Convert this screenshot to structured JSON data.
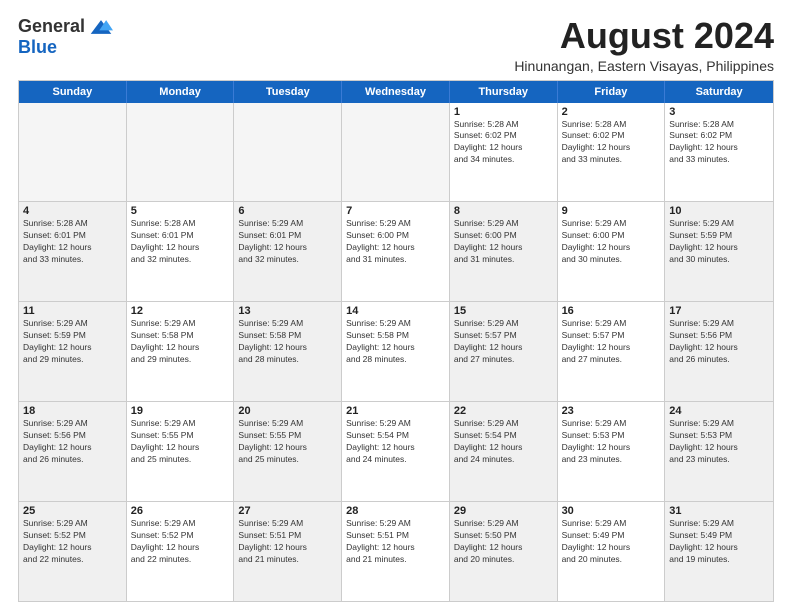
{
  "logo": {
    "general": "General",
    "blue": "Blue"
  },
  "title": "August 2024",
  "location": "Hinunangan, Eastern Visayas, Philippines",
  "header": {
    "days": [
      "Sunday",
      "Monday",
      "Tuesday",
      "Wednesday",
      "Thursday",
      "Friday",
      "Saturday"
    ]
  },
  "weeks": [
    [
      {
        "day": "",
        "info": "",
        "empty": true
      },
      {
        "day": "",
        "info": "",
        "empty": true
      },
      {
        "day": "",
        "info": "",
        "empty": true
      },
      {
        "day": "",
        "info": "",
        "empty": true
      },
      {
        "day": "1",
        "info": "Sunrise: 5:28 AM\nSunset: 6:02 PM\nDaylight: 12 hours\nand 34 minutes."
      },
      {
        "day": "2",
        "info": "Sunrise: 5:28 AM\nSunset: 6:02 PM\nDaylight: 12 hours\nand 33 minutes."
      },
      {
        "day": "3",
        "info": "Sunrise: 5:28 AM\nSunset: 6:02 PM\nDaylight: 12 hours\nand 33 minutes."
      }
    ],
    [
      {
        "day": "4",
        "info": "Sunrise: 5:28 AM\nSunset: 6:01 PM\nDaylight: 12 hours\nand 33 minutes.",
        "shaded": true
      },
      {
        "day": "5",
        "info": "Sunrise: 5:28 AM\nSunset: 6:01 PM\nDaylight: 12 hours\nand 32 minutes."
      },
      {
        "day": "6",
        "info": "Sunrise: 5:29 AM\nSunset: 6:01 PM\nDaylight: 12 hours\nand 32 minutes.",
        "shaded": true
      },
      {
        "day": "7",
        "info": "Sunrise: 5:29 AM\nSunset: 6:00 PM\nDaylight: 12 hours\nand 31 minutes."
      },
      {
        "day": "8",
        "info": "Sunrise: 5:29 AM\nSunset: 6:00 PM\nDaylight: 12 hours\nand 31 minutes.",
        "shaded": true
      },
      {
        "day": "9",
        "info": "Sunrise: 5:29 AM\nSunset: 6:00 PM\nDaylight: 12 hours\nand 30 minutes."
      },
      {
        "day": "10",
        "info": "Sunrise: 5:29 AM\nSunset: 5:59 PM\nDaylight: 12 hours\nand 30 minutes.",
        "shaded": true
      }
    ],
    [
      {
        "day": "11",
        "info": "Sunrise: 5:29 AM\nSunset: 5:59 PM\nDaylight: 12 hours\nand 29 minutes.",
        "shaded": true
      },
      {
        "day": "12",
        "info": "Sunrise: 5:29 AM\nSunset: 5:58 PM\nDaylight: 12 hours\nand 29 minutes."
      },
      {
        "day": "13",
        "info": "Sunrise: 5:29 AM\nSunset: 5:58 PM\nDaylight: 12 hours\nand 28 minutes.",
        "shaded": true
      },
      {
        "day": "14",
        "info": "Sunrise: 5:29 AM\nSunset: 5:58 PM\nDaylight: 12 hours\nand 28 minutes."
      },
      {
        "day": "15",
        "info": "Sunrise: 5:29 AM\nSunset: 5:57 PM\nDaylight: 12 hours\nand 27 minutes.",
        "shaded": true
      },
      {
        "day": "16",
        "info": "Sunrise: 5:29 AM\nSunset: 5:57 PM\nDaylight: 12 hours\nand 27 minutes."
      },
      {
        "day": "17",
        "info": "Sunrise: 5:29 AM\nSunset: 5:56 PM\nDaylight: 12 hours\nand 26 minutes.",
        "shaded": true
      }
    ],
    [
      {
        "day": "18",
        "info": "Sunrise: 5:29 AM\nSunset: 5:56 PM\nDaylight: 12 hours\nand 26 minutes.",
        "shaded": true
      },
      {
        "day": "19",
        "info": "Sunrise: 5:29 AM\nSunset: 5:55 PM\nDaylight: 12 hours\nand 25 minutes."
      },
      {
        "day": "20",
        "info": "Sunrise: 5:29 AM\nSunset: 5:55 PM\nDaylight: 12 hours\nand 25 minutes.",
        "shaded": true
      },
      {
        "day": "21",
        "info": "Sunrise: 5:29 AM\nSunset: 5:54 PM\nDaylight: 12 hours\nand 24 minutes."
      },
      {
        "day": "22",
        "info": "Sunrise: 5:29 AM\nSunset: 5:54 PM\nDaylight: 12 hours\nand 24 minutes.",
        "shaded": true
      },
      {
        "day": "23",
        "info": "Sunrise: 5:29 AM\nSunset: 5:53 PM\nDaylight: 12 hours\nand 23 minutes."
      },
      {
        "day": "24",
        "info": "Sunrise: 5:29 AM\nSunset: 5:53 PM\nDaylight: 12 hours\nand 23 minutes.",
        "shaded": true
      }
    ],
    [
      {
        "day": "25",
        "info": "Sunrise: 5:29 AM\nSunset: 5:52 PM\nDaylight: 12 hours\nand 22 minutes.",
        "shaded": true
      },
      {
        "day": "26",
        "info": "Sunrise: 5:29 AM\nSunset: 5:52 PM\nDaylight: 12 hours\nand 22 minutes."
      },
      {
        "day": "27",
        "info": "Sunrise: 5:29 AM\nSunset: 5:51 PM\nDaylight: 12 hours\nand 21 minutes.",
        "shaded": true
      },
      {
        "day": "28",
        "info": "Sunrise: 5:29 AM\nSunset: 5:51 PM\nDaylight: 12 hours\nand 21 minutes."
      },
      {
        "day": "29",
        "info": "Sunrise: 5:29 AM\nSunset: 5:50 PM\nDaylight: 12 hours\nand 20 minutes.",
        "shaded": true
      },
      {
        "day": "30",
        "info": "Sunrise: 5:29 AM\nSunset: 5:49 PM\nDaylight: 12 hours\nand 20 minutes."
      },
      {
        "day": "31",
        "info": "Sunrise: 5:29 AM\nSunset: 5:49 PM\nDaylight: 12 hours\nand 19 minutes.",
        "shaded": true
      }
    ]
  ]
}
